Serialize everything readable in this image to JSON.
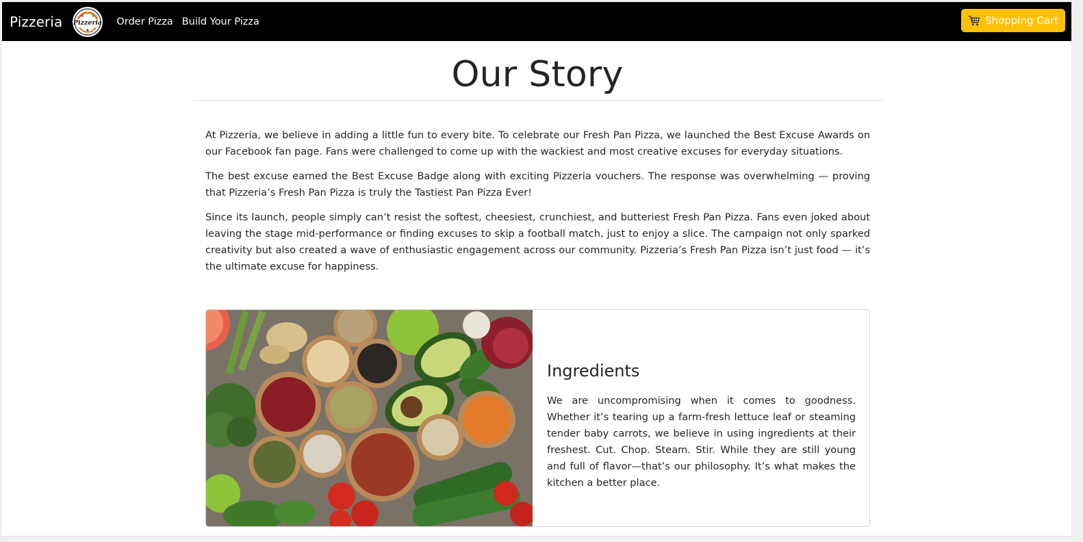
{
  "navbar": {
    "brand": "Pizzeria",
    "logo_text": "Pizzeria",
    "links": [
      "Order Pizza",
      "Build Your Pizza"
    ],
    "cart_label": "Shopping Cart",
    "cart_color": "#ffc107",
    "background": "#000000"
  },
  "page": {
    "title": "Our Story",
    "paragraphs": [
      "At Pizzeria, we believe in adding a little fun to every bite. To celebrate our Fresh Pan Pizza, we launched the Best Excuse Awards on our Facebook fan page. Fans were challenged to come up with the wackiest and most creative excuses for everyday situations.",
      "The best excuse earned the Best Excuse Badge along with exciting Pizzeria vouchers. The response was overwhelming — proving that Pizzeria’s Fresh Pan Pizza is truly the Tastiest Pan Pizza Ever!",
      "Since its launch, people simply can’t resist the softest, cheesiest, crunchiest, and butteriest Fresh Pan Pizza. Fans even joked about leaving the stage mid-performance or finding excuses to skip a football match, just to enjoy a slice. The campaign not only sparked creativity but also created a wave of enthusiastic engagement across our community. Pizzeria’s Fresh Pan Pizza isn’t just food — it’s the ultimate excuse for happiness."
    ]
  },
  "card": {
    "image_icon": "ingredients-photo",
    "title": "Ingredients",
    "text": "We are uncompromising when it comes to goodness. Whether it’s tearing up a farm-fresh lettuce leaf or steaming tender baby carrots, we believe in using ingredients at their freshest. Cut. Chop. Steam. Stir. While they are still young and full of flavor—that’s our philosophy. It’s what makes the kitchen a better place."
  }
}
